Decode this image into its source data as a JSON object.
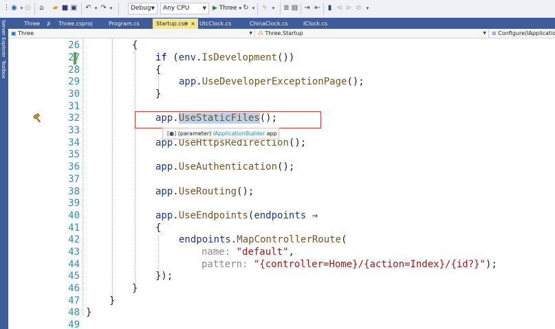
{
  "toolbar": {
    "config": "Debug",
    "platform": "Any CPU",
    "run_target": "Three",
    "icons": [
      "nav-back-icon",
      "nav-forward-icon",
      "new-item-icon",
      "open-folder-icon",
      "save-icon",
      "save-all-icon",
      "undo-icon",
      "redo-icon",
      "play-icon",
      "refresh-icon",
      "hot-reload-icon",
      "format-icon",
      "layout-icon",
      "indent-icon",
      "outdent-icon",
      "bookmark-icon",
      "prev-bookmark-icon",
      "next-bookmark-icon",
      "clear-bookmarks-icon"
    ]
  },
  "side_rail": {
    "server_explorer": "Server Explorer",
    "toolbox": "Toolbox"
  },
  "tabs": [
    {
      "label": "Three",
      "pin": "⊅"
    },
    {
      "label": "Three.csproj"
    },
    {
      "label": "Program.cs"
    },
    {
      "label": "Startup.cs",
      "pin": "⊕",
      "close": "×",
      "active": true
    },
    {
      "label": "UtcClock.cs"
    },
    {
      "label": "ChinaClock.cs"
    },
    {
      "label": "IClock.cs"
    }
  ],
  "navbar": {
    "project": "Three",
    "type": "Three.Startup",
    "member": "Configure(IApplicationBu"
  },
  "editor": {
    "line_numbers": [
      "26",
      "27",
      "28",
      "29",
      "30",
      "31",
      "32",
      "33",
      "34",
      "35",
      "36",
      "37",
      "38",
      "39",
      "40",
      "41",
      "42",
      "43",
      "44",
      "45",
      "46",
      "47",
      "48",
      "49"
    ],
    "code": {
      "l26": "{",
      "l27_kw": "if",
      "l27_open": " (",
      "l27_env": "env",
      "l27_dot": ".",
      "l27_method": "IsDevelopment",
      "l27_close": "())",
      "l28": "{",
      "l29_app": "app",
      "l29_method": "UseDeveloperExceptionPage",
      "l29_rest": "();",
      "l30": "}",
      "l32_app": "app",
      "l32_method": "UseStaticFiles",
      "l32_rest": "();",
      "l34_app": "app",
      "l34_method": "UseHttpsRedirection",
      "l34_rest": "();",
      "l36_app": "app",
      "l36_method": "UseAuthentication",
      "l36_rest": "();",
      "l38_app": "app",
      "l38_method": "UseRouting",
      "l38_rest": "();",
      "l40_app": "app",
      "l40_method": "UseEndpoints",
      "l40_open": "(",
      "l40_param": "endpoints",
      "l40_arrow": " ⇒",
      "l41": "{",
      "l42_obj": "endpoints",
      "l42_method": "MapControllerRoute",
      "l42_rest": "(",
      "l43_name": "name:",
      "l43_val": "\"default\"",
      "l43_rest": ",",
      "l44_name": "pattern:",
      "l44_val": "\"{controller=Home}/{action=Index}/{id?}\"",
      "l44_rest": ");",
      "l45": "});",
      "l46": "}",
      "l47": "}",
      "l48": "}"
    },
    "tooltip": {
      "icon": "[●]",
      "kind": "(parameter)",
      "type": "IApplicationBuilder",
      "name": "app"
    }
  },
  "colors": {
    "keyword": "#0000ff",
    "identifier": "#1f377f",
    "method": "#74531f",
    "string": "#a31515",
    "line_number": "#2b91af",
    "accent_blue": "#3e5c9a",
    "active_tab": "#f7e68a",
    "highlight_box": "#d9352f"
  }
}
